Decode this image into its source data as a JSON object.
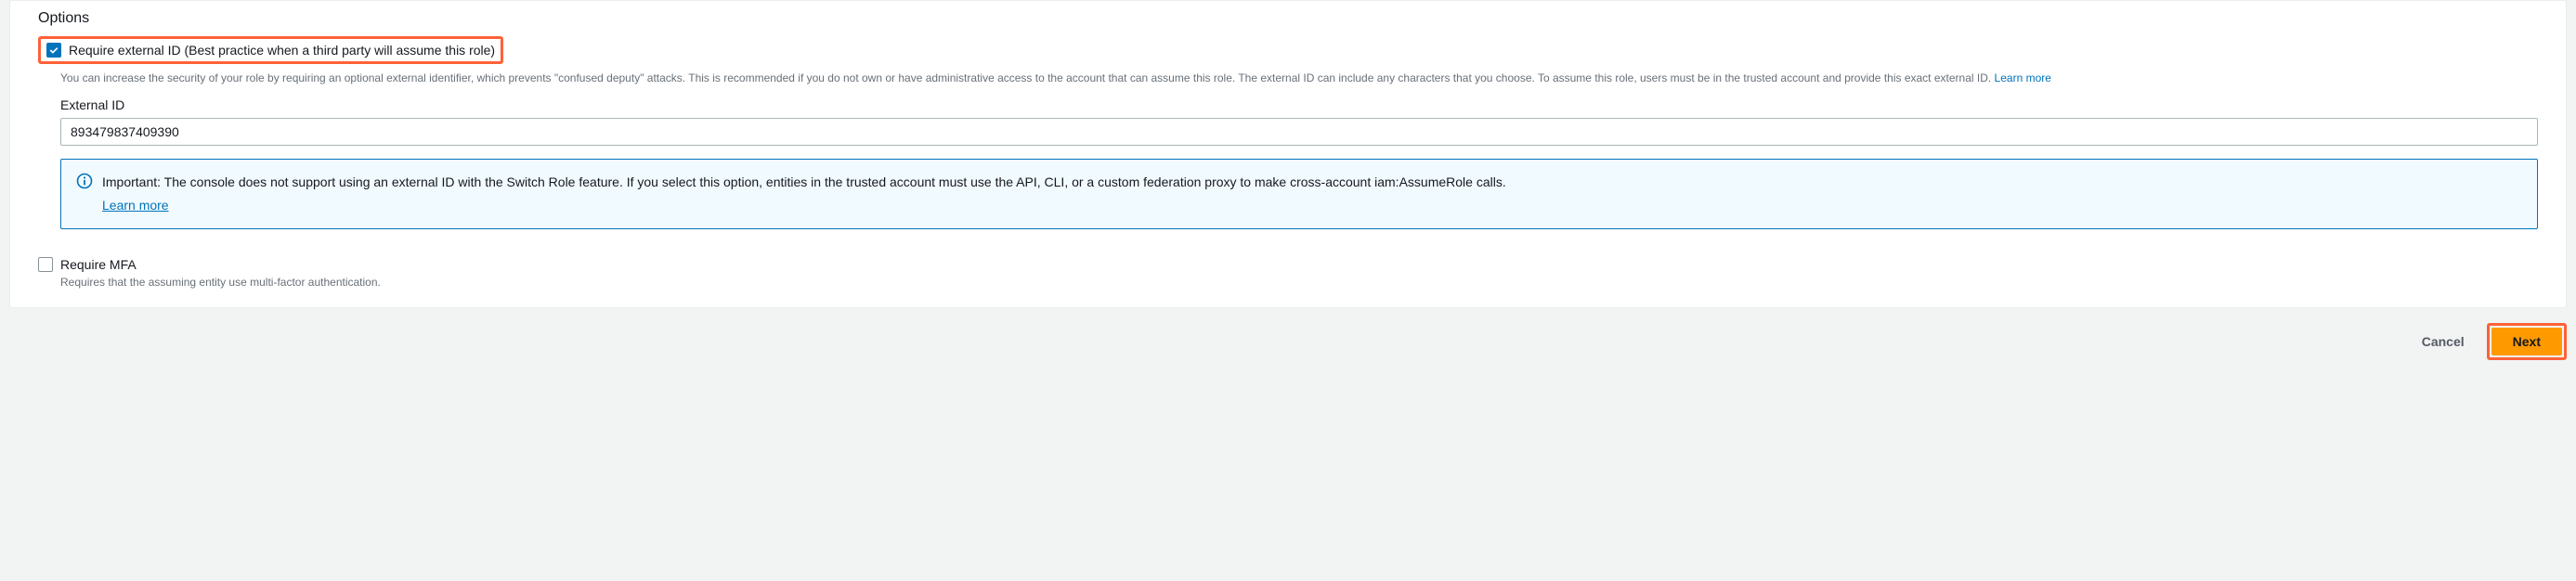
{
  "options": {
    "title": "Options",
    "requireExternalId": {
      "checked": true,
      "label": "Require external ID (Best practice when a third party will assume this role)",
      "description": "You can increase the security of your role by requiring an optional external identifier, which prevents \"confused deputy\" attacks. This is recommended if you do not own or have administrative access to the account that can assume this role. The external ID can include any characters that you choose. To assume this role, users must be in the trusted account and provide this exact external ID.",
      "learnMore": "Learn more"
    },
    "externalId": {
      "label": "External ID",
      "value": "893479837409390"
    },
    "infoAlert": {
      "text": "Important: The console does not support using an external ID with the Switch Role feature. If you select this option, entities in the trusted account must use the API, CLI, or a custom federation proxy to make cross-account iam:AssumeRole calls.",
      "learnMore": "Learn more"
    },
    "requireMfa": {
      "checked": false,
      "label": "Require MFA",
      "description": "Requires that the assuming entity use multi-factor authentication."
    }
  },
  "footer": {
    "cancel": "Cancel",
    "next": "Next"
  }
}
